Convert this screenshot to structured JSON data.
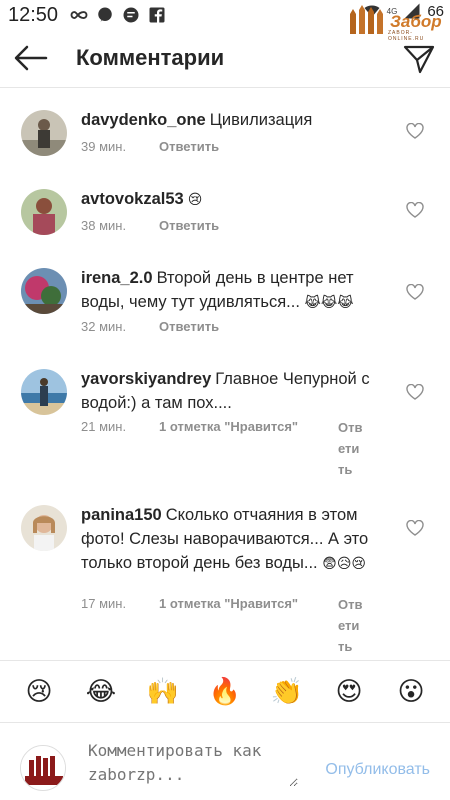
{
  "status_bar": {
    "time": "12:50",
    "network": "4G",
    "battery": "66",
    "icons": [
      "infinity-icon",
      "message-icon",
      "chat-icon",
      "facebook-icon",
      "wifi-icon",
      "signal-icon"
    ]
  },
  "watermark": {
    "text": "Забор",
    "subtitle": "ZABOR-ONLINE.RU"
  },
  "header": {
    "title": "Комментарии"
  },
  "comments": [
    {
      "username": "davydenko_one",
      "text": "Цивилизация",
      "emoji": "",
      "time": "39 мин.",
      "likes": "",
      "reply": "Ответить"
    },
    {
      "username": "avtovokzal53",
      "text": "",
      "emoji": "😢",
      "time": "38 мин.",
      "likes": "",
      "reply": "Ответить"
    },
    {
      "username": "irena_2.0",
      "text": "Второй день в центре нет воды, чему тут удивляться...",
      "emoji": "😹😹😹",
      "time": "32 мин.",
      "likes": "",
      "reply": "Ответить"
    },
    {
      "username": "yavorskiyandrey",
      "text": "Главное Чепурной с водой:) а там пох....",
      "emoji": "",
      "time": "21 мин.",
      "likes": "1 отметка \"Нравится\"",
      "reply": "Ответить"
    },
    {
      "username": "panina150",
      "text": "Сколько отчаяния в этом фото! Слезы наворачиваются... А это только второй день без воды...",
      "emoji": "😨😥😢",
      "time": "17 мин.",
      "likes": "1 отметка \"Нравится\"",
      "reply": "Ответить"
    }
  ],
  "emoji_bar": [
    "😢",
    "😂",
    "🙌",
    "🔥",
    "👏",
    "😍",
    "😮"
  ],
  "input": {
    "placeholder": "Комментировать как zaborzp...",
    "publish_label": "Опубликовать"
  },
  "colors": {
    "accent": "#3897f0",
    "publish_disabled": "#93bde9",
    "muted": "#8e8e8e",
    "text": "#262626",
    "watermark": "#d07a2a"
  }
}
